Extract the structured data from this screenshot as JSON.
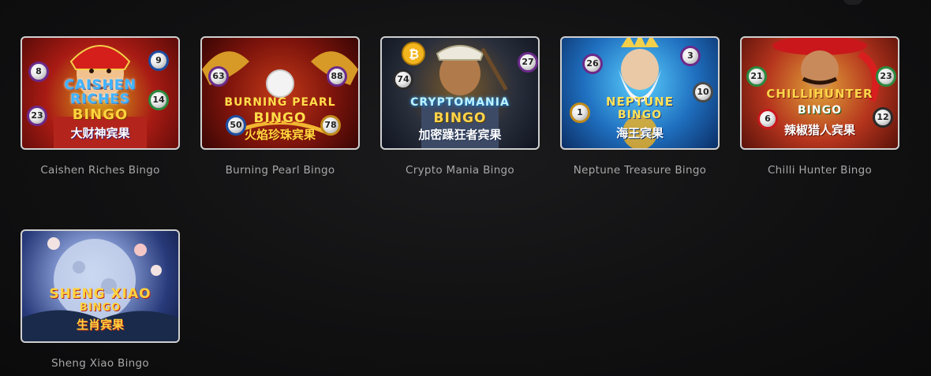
{
  "games": [
    {
      "title": "Caishen Riches Bingo",
      "logo_lines": [
        "CAISHEN",
        "RICHES",
        "BINGO"
      ],
      "cn": "大财神宾果",
      "balls": [
        "8",
        "9",
        "14",
        "23"
      ]
    },
    {
      "title": "Burning Pearl Bingo",
      "logo_lines": [
        "BURNING PEARL",
        "BINGO"
      ],
      "cn": "火焰珍珠宾果",
      "balls": [
        "63",
        "88",
        "50",
        "78"
      ]
    },
    {
      "title": "Crypto Mania Bingo",
      "logo_lines": [
        "CRYPTOMANIA",
        "BINGO"
      ],
      "cn": "加密躁狂者宾果",
      "balls": [
        "74",
        "27"
      ]
    },
    {
      "title": "Neptune Treasure Bingo",
      "logo_lines": [
        "NEPTUNE",
        "BINGO"
      ],
      "cn": "海王宾果",
      "balls": [
        "26",
        "3",
        "10",
        "1"
      ]
    },
    {
      "title": "Chilli Hunter Bingo",
      "logo_lines": [
        "CHILLIHUNTER",
        "BINGO"
      ],
      "cn": "辣椒猎人宾果",
      "balls": [
        "21",
        "23",
        "6",
        "12"
      ]
    },
    {
      "title": "Sheng Xiao Bingo",
      "logo_lines": [
        "SHENG XIAO",
        "BINGO"
      ],
      "cn": "生肖宾果",
      "balls": []
    }
  ]
}
